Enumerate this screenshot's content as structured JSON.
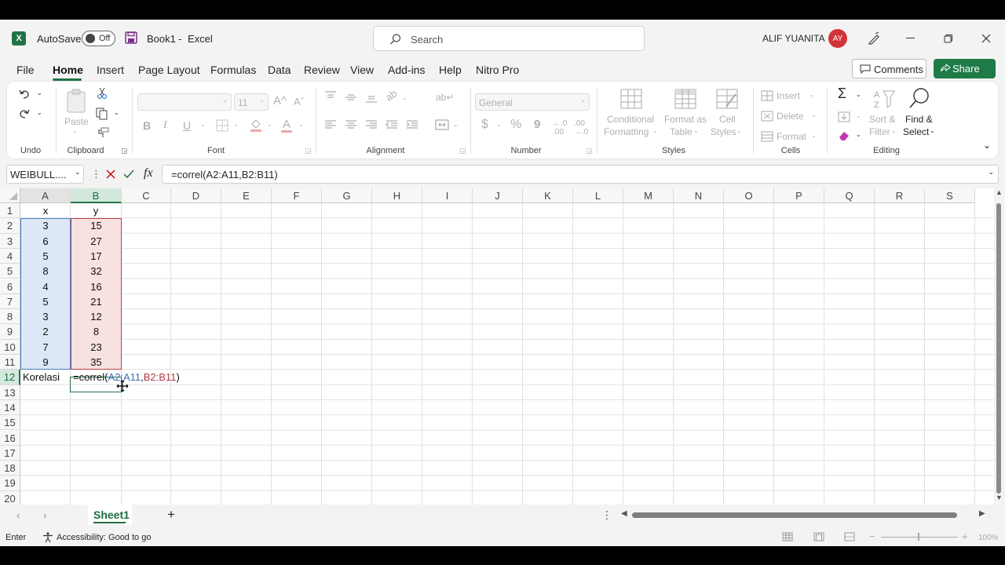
{
  "app": {
    "name": "Excel",
    "book": "Book1",
    "separator": "-",
    "autosave_label": "AutoSave",
    "autosave_state": "Off",
    "search_placeholder": "Search",
    "user": "ALIF YUANITA",
    "user_initials": "AY",
    "accent": "#217346",
    "avatar_color": "#d13438"
  },
  "tabs": [
    "File",
    "Home",
    "Insert",
    "Page Layout",
    "Formulas",
    "Data",
    "Review",
    "View",
    "Add-ins",
    "Help",
    "Nitro Pro"
  ],
  "active_tab": "Home",
  "buttons": {
    "comments": "Comments",
    "share": "Share"
  },
  "ribbon": {
    "undo_group": "Undo",
    "clipboard": {
      "paste": "Paste",
      "label": "Clipboard"
    },
    "font": {
      "size": "11",
      "label": "Font",
      "bold": "B",
      "italic": "I",
      "underline": "U",
      "grow": "A^",
      "shrink": "Aˇ",
      "color": "A"
    },
    "alignment": {
      "label": "Alignment"
    },
    "number": {
      "format": "General",
      "label": "Number",
      "currency": "$",
      "percent": "%",
      "comma": "9"
    },
    "styles": {
      "conditional_1": "Conditional",
      "conditional_2": "Formatting",
      "format_table_1": "Format as",
      "format_table_2": "Table",
      "cell_styles_1": "Cell",
      "cell_styles_2": "Styles",
      "label": "Styles"
    },
    "cells": {
      "insert": "Insert",
      "delete": "Delete",
      "format": "Format",
      "label": "Cells"
    },
    "editing": {
      "sort_1": "Sort &",
      "sort_2": "Filter",
      "find_1": "Find &",
      "find_2": "Select",
      "label": "Editing"
    }
  },
  "formula_bar": {
    "name_box": "WEIBULL....",
    "formula": "=correl(A2:A11,B2:B11)",
    "fx": "fx"
  },
  "columns": [
    "A",
    "B",
    "C",
    "D",
    "E",
    "F",
    "G",
    "H",
    "I",
    "J",
    "K",
    "L",
    "M",
    "N",
    "O",
    "P",
    "Q",
    "R",
    "S"
  ],
  "rows": [
    "1",
    "2",
    "3",
    "4",
    "5",
    "6",
    "7",
    "8",
    "9",
    "10",
    "11",
    "12",
    "13",
    "14",
    "15",
    "16",
    "17",
    "18",
    "19",
    "20"
  ],
  "cells": {
    "headers": {
      "x": "x",
      "y": "y"
    },
    "x_values": [
      "3",
      "6",
      "5",
      "8",
      "4",
      "5",
      "3",
      "2",
      "7",
      "9"
    ],
    "y_values": [
      "15",
      "27",
      "17",
      "32",
      "16",
      "21",
      "12",
      "8",
      "23",
      "35"
    ],
    "label_a12": "Korelasi",
    "edit": {
      "prefix": "=correl(",
      "ref1": "A2:A11",
      "comma": ",",
      "ref2": "B2:B11",
      "suffix": ")"
    }
  },
  "sheet_tab": "Sheet1",
  "status": {
    "mode": "Enter",
    "accessibility": "Accessibility: Good to go",
    "zoom": "100%"
  }
}
